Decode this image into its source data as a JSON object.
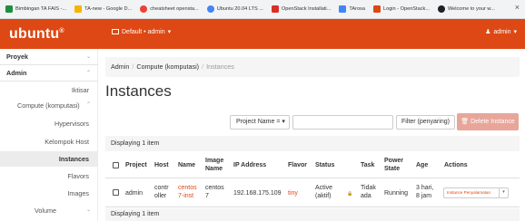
{
  "bookmarks": [
    {
      "label": "Bimbingan TA FAIS -...",
      "color": "#1e8e3e"
    },
    {
      "label": "TA-new - Google D...",
      "color": "#f4b400"
    },
    {
      "label": "cheatsheet opensta...",
      "color": "#ea4335"
    },
    {
      "label": "Ubuntu 20.04 LTS ...",
      "color": "#4285f4"
    },
    {
      "label": "OpenStack Installati...",
      "color": "#d93025"
    },
    {
      "label": "TArosa",
      "color": "#4285f4"
    },
    {
      "label": "Login - OpenStack...",
      "color": "#dd4814"
    },
    {
      "label": "Welcome to your w...",
      "color": "#202124"
    }
  ],
  "bookmark_close": "×",
  "header": {
    "logo": "ubuntu",
    "logo_mark": "®",
    "domain_project": "Default • admin",
    "user": "admin"
  },
  "sidebar": {
    "proyek": "Proyek",
    "admin": "Admin",
    "ikhtisar": "Iktisar",
    "compute": "Compute (komputasi)",
    "hypervisors": "Hypervisors",
    "kelompok_host": "Kelompok Host",
    "instances": "Instances",
    "flavors": "Flavors",
    "images": "Images",
    "volume": "Volume",
    "chev_down": "⌄",
    "chev_up": "⌃"
  },
  "breadcrumb": {
    "admin": "Admin",
    "compute": "Compute (komputasi)",
    "current": "Instances",
    "sep": "/"
  },
  "page_title": "Instances",
  "filter": {
    "select": "Project Name = ▾",
    "input_value": "",
    "button": "Filter (penyaring)",
    "delete_button": "Delete Instance"
  },
  "table": {
    "displaying_top": "Displaying 1 item",
    "displaying_bottom": "Displaying 1 item",
    "headers": {
      "project": "Project",
      "host": "Host",
      "name": "Name",
      "image_name_1": "Image",
      "image_name_2": "Name",
      "ip": "IP Address",
      "flavor": "Flavor",
      "status": "Status",
      "task": "Task",
      "power_1": "Power",
      "power_2": "State",
      "age": "Age",
      "actions": "Actions"
    },
    "row": {
      "project": "admin",
      "host_1": "contr",
      "host_2": "oller",
      "name_1": "centos",
      "name_2": "7-inst",
      "image_1": "centos",
      "image_2": "7",
      "ip": "192.168.175.109",
      "flavor": "tiny",
      "status_1": "Active",
      "status_2": "(aktif)",
      "task_1": "Tidak",
      "task_2": "ada",
      "power": "Running",
      "age_1": "3 hari,",
      "age_2": "8 jam",
      "action": "Instance Penyalamatan",
      "action_caret": "▾"
    }
  },
  "colors": {
    "brand": "#dd4814",
    "delete": "#e8a69a",
    "sidebar_active": "#ececec"
  }
}
